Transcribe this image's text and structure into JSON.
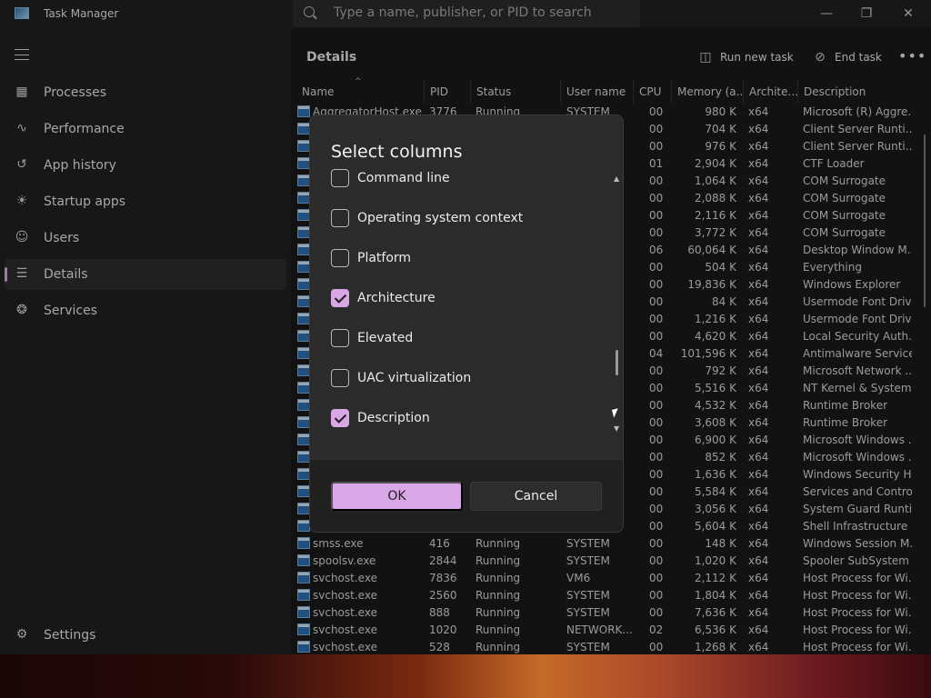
{
  "window": {
    "title": "Task Manager",
    "search_placeholder": "Type a name, publisher, or PID to search"
  },
  "sidebar": {
    "items": [
      {
        "label": "Processes",
        "icon": "processes-icon"
      },
      {
        "label": "Performance",
        "icon": "performance-icon"
      },
      {
        "label": "App history",
        "icon": "app-history-icon"
      },
      {
        "label": "Startup apps",
        "icon": "startup-apps-icon"
      },
      {
        "label": "Users",
        "icon": "users-icon"
      },
      {
        "label": "Details",
        "icon": "details-icon",
        "active": true
      },
      {
        "label": "Services",
        "icon": "services-icon"
      }
    ],
    "settings_label": "Settings"
  },
  "main": {
    "title": "Details",
    "run_new_task": "Run new task",
    "end_task": "End task",
    "columns": [
      "Name",
      "PID",
      "Status",
      "User name",
      "CPU",
      "Memory (a...",
      "Archite...",
      "Description"
    ],
    "rows": [
      {
        "name": "AggregatorHost.exe",
        "pid": "3776",
        "status": "Running",
        "user": "SYSTEM",
        "cpu": "00",
        "mem": "980 K",
        "arch": "x64",
        "desc": "Microsoft (R) Aggre..."
      },
      {
        "name": "",
        "pid": "",
        "status": "",
        "user": "",
        "cpu": "00",
        "mem": "704 K",
        "arch": "x64",
        "desc": "Client Server Runti..."
      },
      {
        "name": "",
        "pid": "",
        "status": "",
        "user": "",
        "cpu": "00",
        "mem": "976 K",
        "arch": "x64",
        "desc": "Client Server Runti..."
      },
      {
        "name": "",
        "pid": "",
        "status": "",
        "user": "",
        "cpu": "01",
        "mem": "2,904 K",
        "arch": "x64",
        "desc": "CTF Loader"
      },
      {
        "name": "",
        "pid": "",
        "status": "",
        "user": "",
        "cpu": "00",
        "mem": "1,064 K",
        "arch": "x64",
        "desc": "COM Surrogate"
      },
      {
        "name": "",
        "pid": "",
        "status": "",
        "user": "",
        "cpu": "00",
        "mem": "2,088 K",
        "arch": "x64",
        "desc": "COM Surrogate"
      },
      {
        "name": "",
        "pid": "",
        "status": "",
        "user": "",
        "cpu": "00",
        "mem": "2,116 K",
        "arch": "x64",
        "desc": "COM Surrogate"
      },
      {
        "name": "",
        "pid": "",
        "status": "",
        "user": "",
        "cpu": "00",
        "mem": "3,772 K",
        "arch": "x64",
        "desc": "COM Surrogate"
      },
      {
        "name": "",
        "pid": "",
        "status": "",
        "user": "",
        "cpu": "06",
        "mem": "60,064 K",
        "arch": "x64",
        "desc": "Desktop Window M..."
      },
      {
        "name": "",
        "pid": "",
        "status": "",
        "user": "",
        "cpu": "00",
        "mem": "504 K",
        "arch": "x64",
        "desc": "Everything"
      },
      {
        "name": "",
        "pid": "",
        "status": "",
        "user": "",
        "cpu": "00",
        "mem": "19,836 K",
        "arch": "x64",
        "desc": "Windows Explorer"
      },
      {
        "name": "",
        "pid": "",
        "status": "",
        "user": "",
        "cpu": "00",
        "mem": "84 K",
        "arch": "x64",
        "desc": "Usermode Font Driv..."
      },
      {
        "name": "",
        "pid": "",
        "status": "",
        "user": "",
        "cpu": "00",
        "mem": "1,216 K",
        "arch": "x64",
        "desc": "Usermode Font Driv..."
      },
      {
        "name": "",
        "pid": "",
        "status": "",
        "user": "",
        "cpu": "00",
        "mem": "4,620 K",
        "arch": "x64",
        "desc": "Local Security Auth..."
      },
      {
        "name": "",
        "pid": "",
        "status": "",
        "user": "",
        "cpu": "04",
        "mem": "101,596 K",
        "arch": "x64",
        "desc": "Antimalware Service..."
      },
      {
        "name": "",
        "pid": "",
        "status": "",
        "user": "",
        "cpu": "00",
        "mem": "792 K",
        "arch": "x64",
        "desc": "Microsoft Network ..."
      },
      {
        "name": "",
        "pid": "",
        "status": "",
        "user": "",
        "cpu": "00",
        "mem": "5,516 K",
        "arch": "x64",
        "desc": "NT Kernel & System"
      },
      {
        "name": "",
        "pid": "",
        "status": "",
        "user": "",
        "cpu": "00",
        "mem": "4,532 K",
        "arch": "x64",
        "desc": "Runtime Broker"
      },
      {
        "name": "",
        "pid": "",
        "status": "",
        "user": "",
        "cpu": "00",
        "mem": "3,608 K",
        "arch": "x64",
        "desc": "Runtime Broker"
      },
      {
        "name": "",
        "pid": "",
        "status": "",
        "user": "",
        "cpu": "00",
        "mem": "6,900 K",
        "arch": "x64",
        "desc": "Microsoft Windows ..."
      },
      {
        "name": "",
        "pid": "",
        "status": "",
        "user": "",
        "cpu": "00",
        "mem": "852 K",
        "arch": "x64",
        "desc": "Microsoft Windows ..."
      },
      {
        "name": "",
        "pid": "",
        "status": "",
        "user": "",
        "cpu": "00",
        "mem": "1,636 K",
        "arch": "x64",
        "desc": "Windows Security H..."
      },
      {
        "name": "",
        "pid": "",
        "status": "",
        "user": "",
        "cpu": "00",
        "mem": "5,584 K",
        "arch": "x64",
        "desc": "Services and Contro..."
      },
      {
        "name": "",
        "pid": "",
        "status": "",
        "user": "",
        "cpu": "00",
        "mem": "3,056 K",
        "arch": "x64",
        "desc": "System Guard Runti..."
      },
      {
        "name": "",
        "pid": "",
        "status": "",
        "user": "",
        "cpu": "00",
        "mem": "5,604 K",
        "arch": "x64",
        "desc": "Shell Infrastructure ..."
      },
      {
        "name": "smss.exe",
        "pid": "416",
        "status": "Running",
        "user": "SYSTEM",
        "cpu": "00",
        "mem": "148 K",
        "arch": "x64",
        "desc": "Windows Session M..."
      },
      {
        "name": "spoolsv.exe",
        "pid": "2844",
        "status": "Running",
        "user": "SYSTEM",
        "cpu": "00",
        "mem": "1,020 K",
        "arch": "x64",
        "desc": "Spooler SubSystem ..."
      },
      {
        "name": "svchost.exe",
        "pid": "7836",
        "status": "Running",
        "user": "VM6",
        "cpu": "00",
        "mem": "2,112 K",
        "arch": "x64",
        "desc": "Host Process for Wi..."
      },
      {
        "name": "svchost.exe",
        "pid": "2560",
        "status": "Running",
        "user": "SYSTEM",
        "cpu": "00",
        "mem": "1,804 K",
        "arch": "x64",
        "desc": "Host Process for Wi..."
      },
      {
        "name": "svchost.exe",
        "pid": "888",
        "status": "Running",
        "user": "SYSTEM",
        "cpu": "00",
        "mem": "7,636 K",
        "arch": "x64",
        "desc": "Host Process for Wi..."
      },
      {
        "name": "svchost.exe",
        "pid": "1020",
        "status": "Running",
        "user": "NETWORK...",
        "cpu": "02",
        "mem": "6,536 K",
        "arch": "x64",
        "desc": "Host Process for Wi..."
      },
      {
        "name": "svchost.exe",
        "pid": "528",
        "status": "Running",
        "user": "SYSTEM",
        "cpu": "00",
        "mem": "1,268 K",
        "arch": "x64",
        "desc": "Host Process for Wi..."
      }
    ]
  },
  "dialog": {
    "title": "Select columns",
    "options": [
      {
        "label": "Command line",
        "checked": false
      },
      {
        "label": "Operating system context",
        "checked": false
      },
      {
        "label": "Platform",
        "checked": false
      },
      {
        "label": "Architecture",
        "checked": true
      },
      {
        "label": "Elevated",
        "checked": false
      },
      {
        "label": "UAC virtualization",
        "checked": false
      },
      {
        "label": "Description",
        "checked": true
      }
    ],
    "ok_label": "OK",
    "cancel_label": "Cancel"
  },
  "colors": {
    "accent": "#d9a7e5",
    "background": "#202020",
    "dialog_background": "#2b2b2b"
  }
}
